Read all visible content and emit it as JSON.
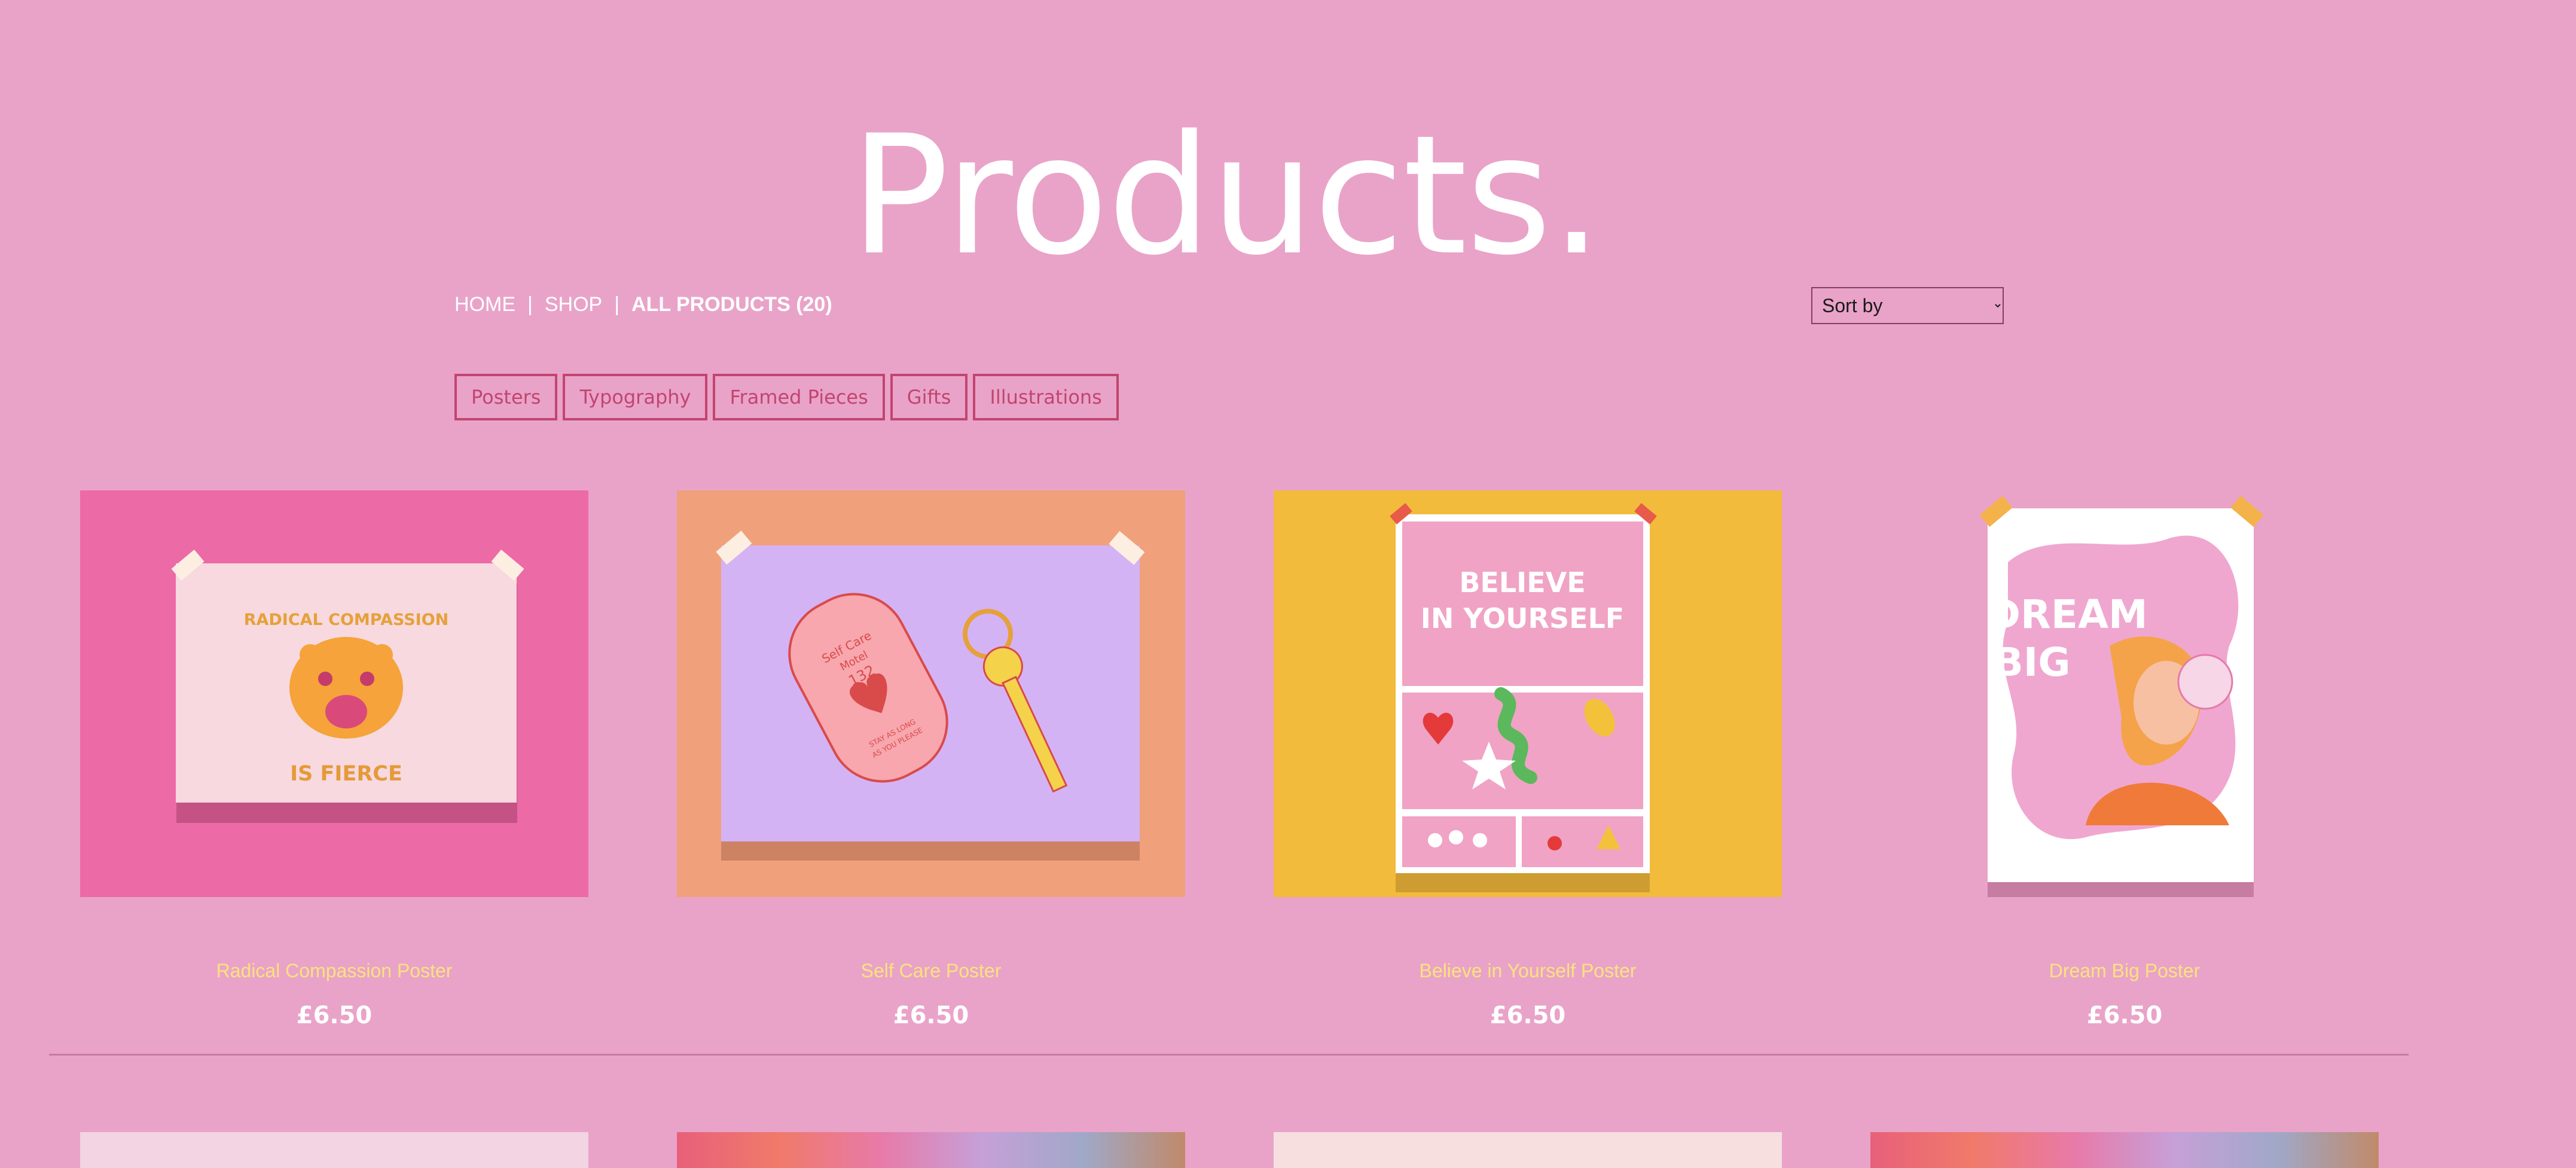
{
  "page": {
    "title": "Products."
  },
  "breadcrumb": {
    "home": "HOME",
    "shop": "SHOP",
    "current": "ALL PRODUCTS (20)",
    "separator": "|"
  },
  "sort": {
    "label": "Sort by"
  },
  "filters": [
    "Posters",
    "Typography",
    "Framed Pieces",
    "Gifts",
    "Illustrations"
  ],
  "products": [
    {
      "name": "Radical Compassion Poster",
      "price": "£6.50",
      "art_text_top": "RADICAL COMPASSION",
      "art_text_bottom": "IS FIERCE",
      "background": "#ec6aa6"
    },
    {
      "name": "Self Care Poster",
      "price": "£6.50",
      "art_text_lines": [
        "Self Care",
        "Motel",
        "132",
        "STAY AS LONG",
        "AS YOU PLEASE"
      ],
      "background": "#f0a17b"
    },
    {
      "name": "Believe in Yourself Poster",
      "price": "£6.50",
      "art_text_lines": [
        "BELIEVE",
        "IN YOURSELF"
      ],
      "background": "#f2bb3c"
    },
    {
      "name": "Dream Big Poster",
      "price": "£6.50",
      "art_text_lines": [
        "DREAM",
        "BIG"
      ],
      "background": "#e9a3c8"
    }
  ],
  "colors": {
    "page_bg": "#e9a3c8",
    "accent": "#c2456f",
    "name": "#fbe27d",
    "price": "#ffffff"
  },
  "icons": {
    "sort": "chevron-down-icon"
  }
}
